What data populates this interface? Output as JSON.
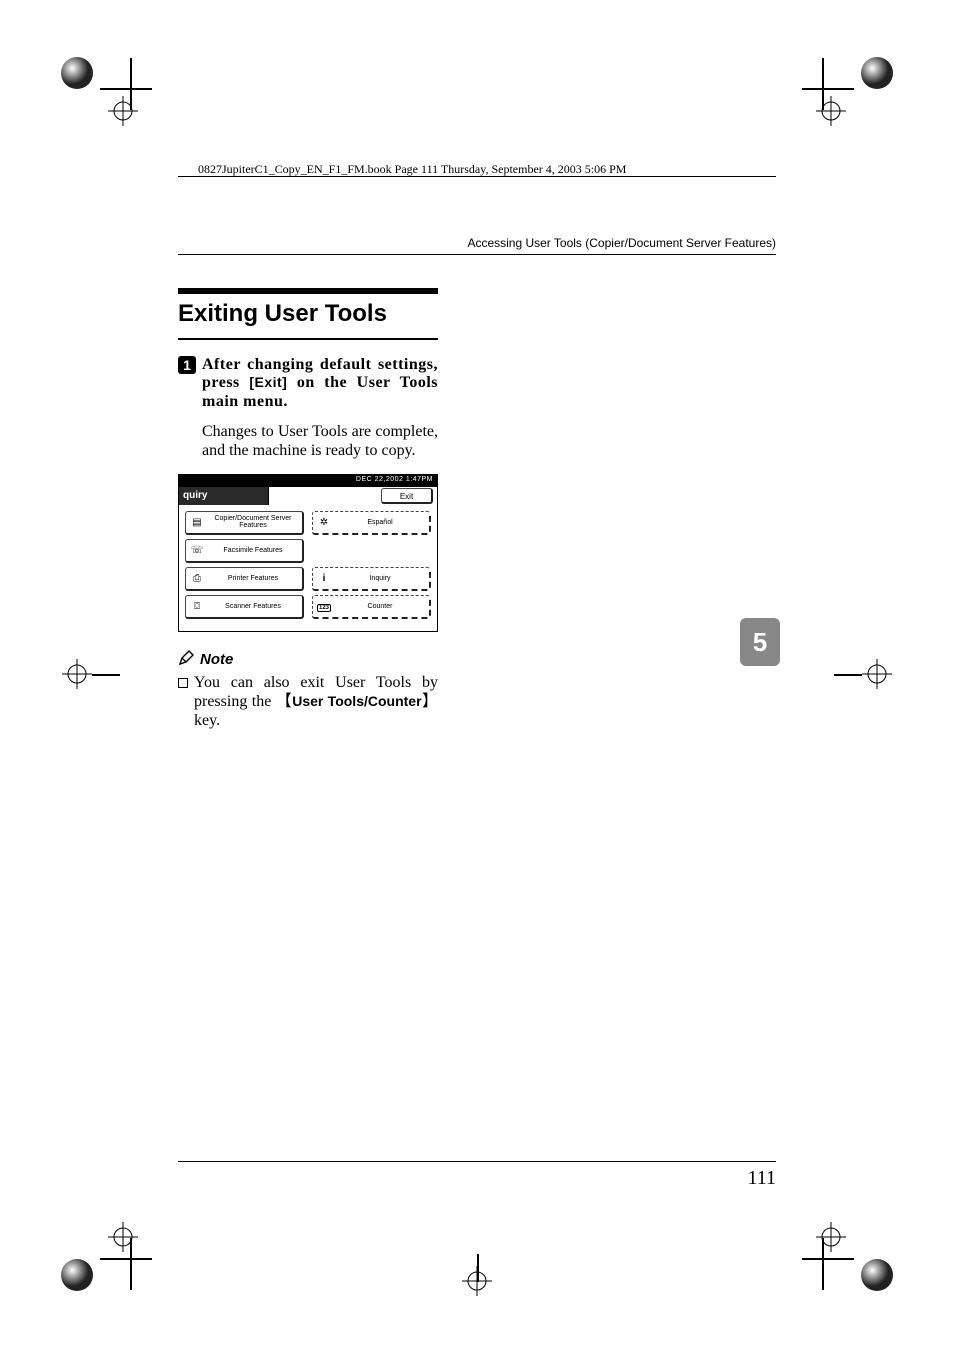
{
  "bookref": "0827JupiterC1_Copy_EN_F1_FM.book  Page 111  Thursday, September 4, 2003  5:06 PM",
  "header": {
    "title": "Accessing User Tools (Copier/Document Server Features)"
  },
  "section": {
    "heading": "Exiting User Tools"
  },
  "step1": {
    "num": "1",
    "before": "After changing default settings, press ",
    "button": "[Exit]",
    "after": " on the User Tools main menu.",
    "para": "Changes to User Tools are complete, and the machine is ready to copy."
  },
  "panel": {
    "topbar": "DEC  22,2002  1:47PM",
    "tab": "quiry",
    "exit": "Exit",
    "left": [
      {
        "label": "Copier/Document Server Features"
      },
      {
        "label": "Facsimile Features"
      },
      {
        "label": "Printer Features"
      },
      {
        "label": "Scanner Features"
      }
    ],
    "right": [
      {
        "label": "Español",
        "dashed": true
      },
      {
        "label": ""
      },
      {
        "label": "Inquiry",
        "dashed": true,
        "icon": "i"
      },
      {
        "label": "Counter",
        "dashed": true,
        "icon": "123"
      }
    ]
  },
  "note": {
    "heading": "Note",
    "item_before": "You can also exit User Tools by pressing the ",
    "item_key": "User Tools/Counter",
    "item_after": " key."
  },
  "thumb": "5",
  "page_number": "111"
}
